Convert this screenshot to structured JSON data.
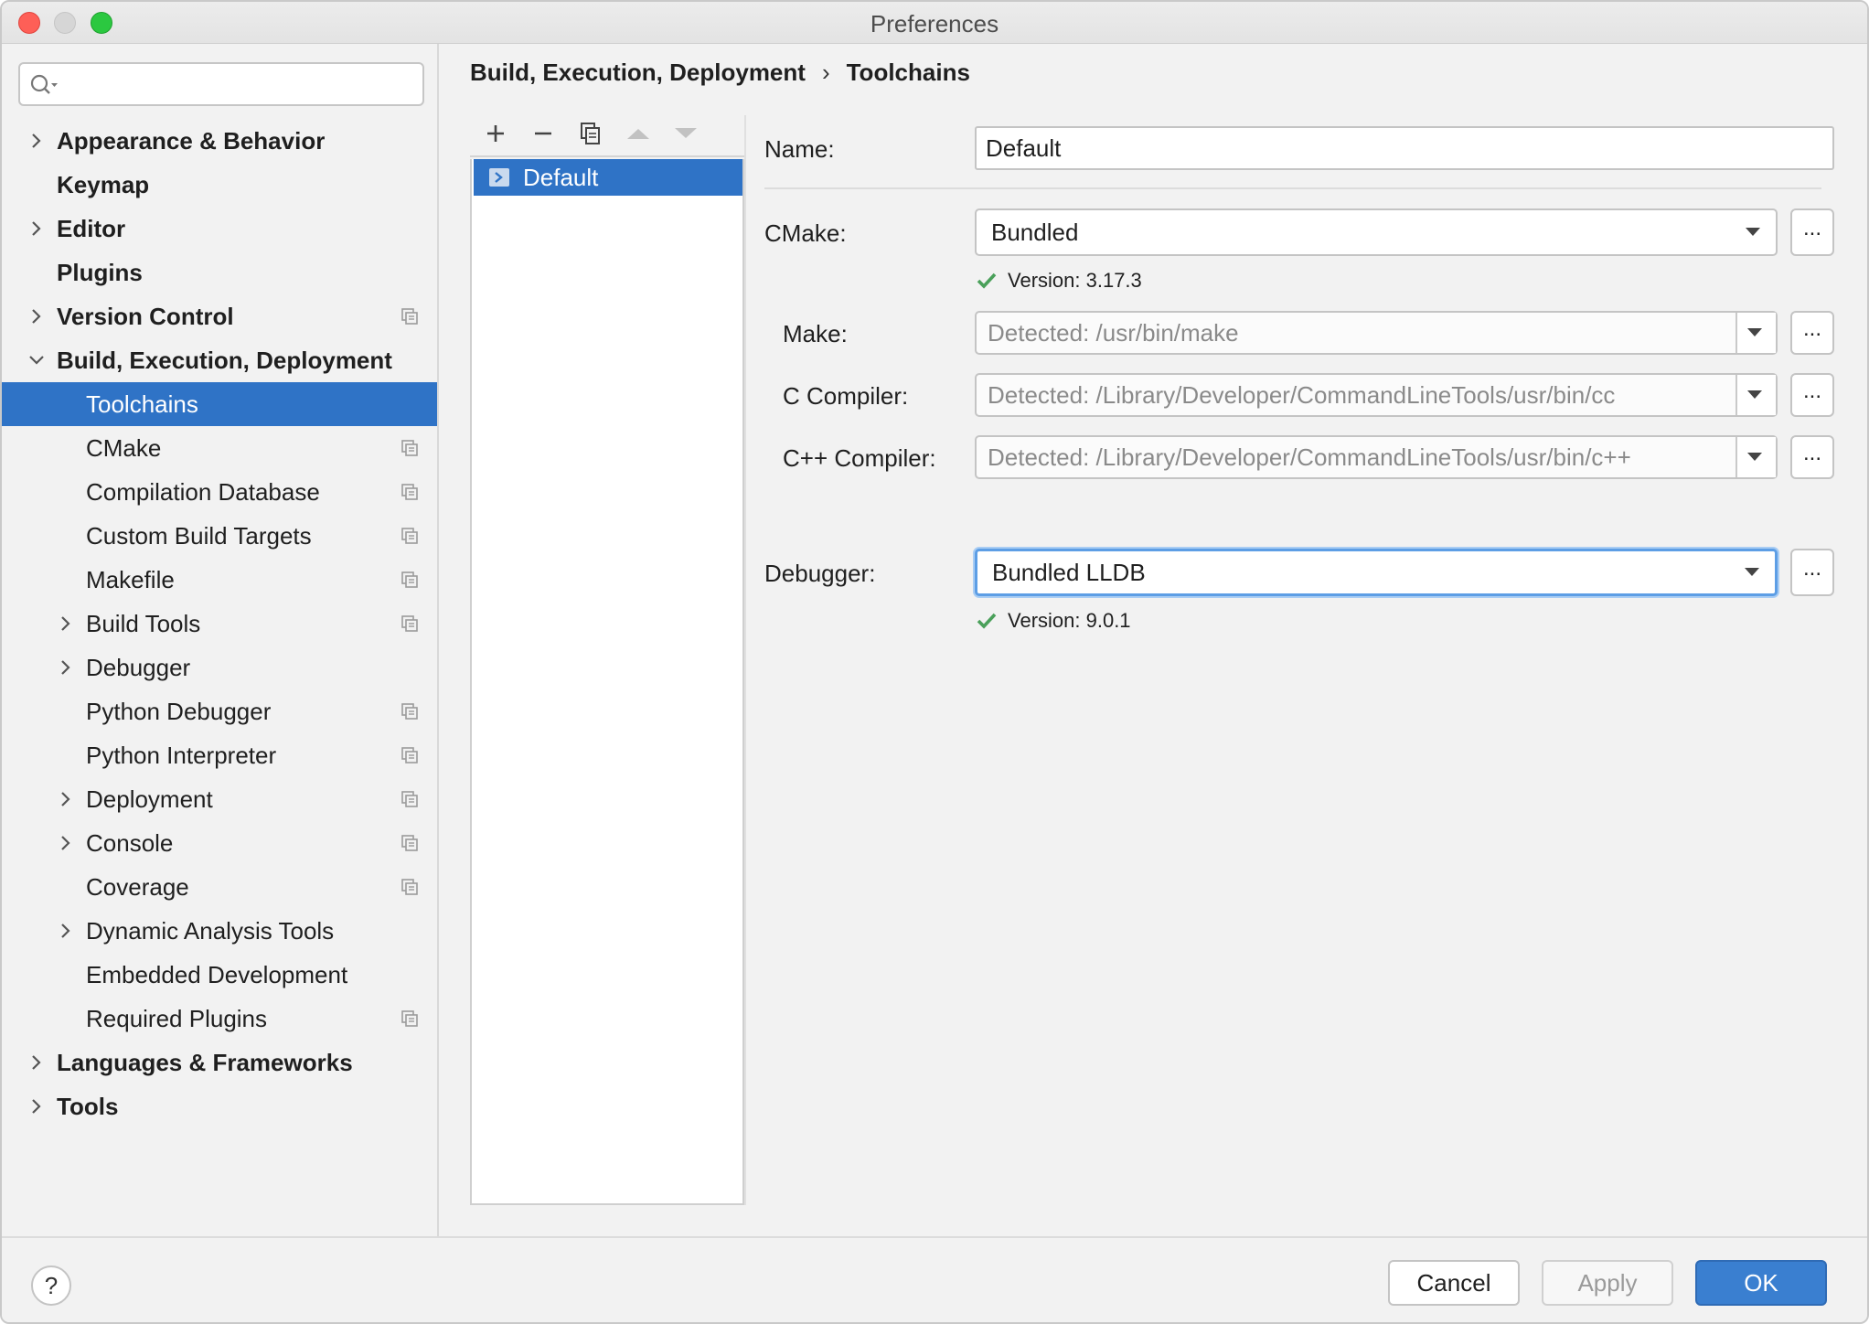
{
  "window": {
    "title": "Preferences"
  },
  "search": {
    "value": "",
    "placeholder": ""
  },
  "sidebar": {
    "items": [
      {
        "label": "Appearance & Behavior"
      },
      {
        "label": "Keymap"
      },
      {
        "label": "Editor"
      },
      {
        "label": "Plugins"
      },
      {
        "label": "Version Control"
      },
      {
        "label": "Build, Execution, Deployment"
      },
      {
        "label": "Toolchains"
      },
      {
        "label": "CMake"
      },
      {
        "label": "Compilation Database"
      },
      {
        "label": "Custom Build Targets"
      },
      {
        "label": "Makefile"
      },
      {
        "label": "Build Tools"
      },
      {
        "label": "Debugger"
      },
      {
        "label": "Python Debugger"
      },
      {
        "label": "Python Interpreter"
      },
      {
        "label": "Deployment"
      },
      {
        "label": "Console"
      },
      {
        "label": "Coverage"
      },
      {
        "label": "Dynamic Analysis Tools"
      },
      {
        "label": "Embedded Development"
      },
      {
        "label": "Required Plugins"
      },
      {
        "label": "Languages & Frameworks"
      },
      {
        "label": "Tools"
      }
    ]
  },
  "breadcrumb": {
    "parent": "Build, Execution, Deployment",
    "separator": "›",
    "current": "Toolchains"
  },
  "toolchains": {
    "items": [
      {
        "label": "Default"
      }
    ]
  },
  "form": {
    "name_label": "Name:",
    "name_value": "Default",
    "cmake_label": "CMake:",
    "cmake_value": "Bundled",
    "cmake_version": "Version: 3.17.3",
    "make_label": "Make:",
    "make_value": "Detected: /usr/bin/make",
    "c_compiler_label": "C Compiler:",
    "c_compiler_value": "Detected: /Library/Developer/CommandLineTools/usr/bin/cc",
    "cpp_compiler_label": "C++ Compiler:",
    "cpp_compiler_value": "Detected: /Library/Developer/CommandLineTools/usr/bin/c++",
    "debugger_label": "Debugger:",
    "debugger_value": "Bundled LLDB",
    "debugger_version": "Version: 9.0.1",
    "browse_label": "..."
  },
  "footer": {
    "help_label": "?",
    "cancel_label": "Cancel",
    "apply_label": "Apply",
    "ok_label": "OK"
  },
  "colors": {
    "selection": "#2f73c6",
    "ok_button": "#3a7fd0",
    "check": "#4aa05a",
    "focus": "#5d9ee5"
  }
}
